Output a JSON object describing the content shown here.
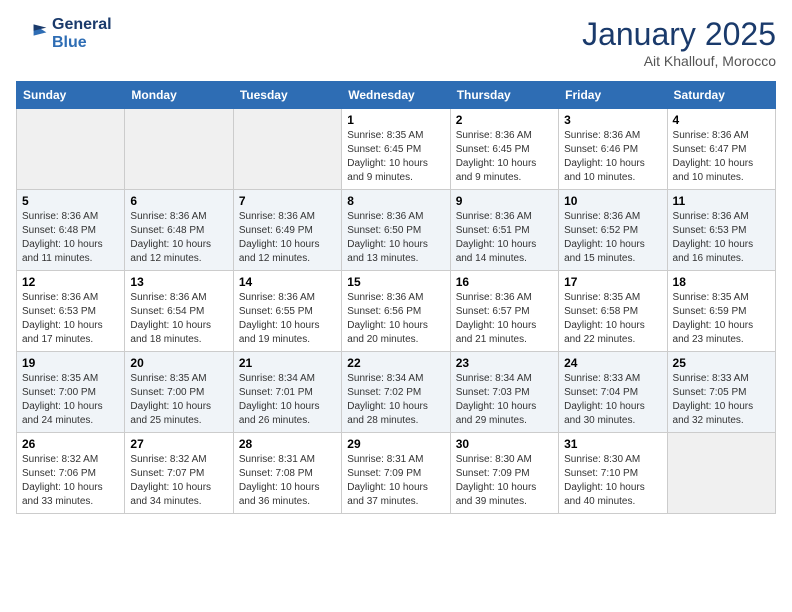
{
  "header": {
    "logo_line1": "General",
    "logo_line2": "Blue",
    "month": "January 2025",
    "location": "Ait Khallouf, Morocco"
  },
  "days_of_week": [
    "Sunday",
    "Monday",
    "Tuesday",
    "Wednesday",
    "Thursday",
    "Friday",
    "Saturday"
  ],
  "weeks": [
    [
      {
        "day": "",
        "info": ""
      },
      {
        "day": "",
        "info": ""
      },
      {
        "day": "",
        "info": ""
      },
      {
        "day": "1",
        "info": "Sunrise: 8:35 AM\nSunset: 6:45 PM\nDaylight: 10 hours\nand 9 minutes."
      },
      {
        "day": "2",
        "info": "Sunrise: 8:36 AM\nSunset: 6:45 PM\nDaylight: 10 hours\nand 9 minutes."
      },
      {
        "day": "3",
        "info": "Sunrise: 8:36 AM\nSunset: 6:46 PM\nDaylight: 10 hours\nand 10 minutes."
      },
      {
        "day": "4",
        "info": "Sunrise: 8:36 AM\nSunset: 6:47 PM\nDaylight: 10 hours\nand 10 minutes."
      }
    ],
    [
      {
        "day": "5",
        "info": "Sunrise: 8:36 AM\nSunset: 6:48 PM\nDaylight: 10 hours\nand 11 minutes."
      },
      {
        "day": "6",
        "info": "Sunrise: 8:36 AM\nSunset: 6:48 PM\nDaylight: 10 hours\nand 12 minutes."
      },
      {
        "day": "7",
        "info": "Sunrise: 8:36 AM\nSunset: 6:49 PM\nDaylight: 10 hours\nand 12 minutes."
      },
      {
        "day": "8",
        "info": "Sunrise: 8:36 AM\nSunset: 6:50 PM\nDaylight: 10 hours\nand 13 minutes."
      },
      {
        "day": "9",
        "info": "Sunrise: 8:36 AM\nSunset: 6:51 PM\nDaylight: 10 hours\nand 14 minutes."
      },
      {
        "day": "10",
        "info": "Sunrise: 8:36 AM\nSunset: 6:52 PM\nDaylight: 10 hours\nand 15 minutes."
      },
      {
        "day": "11",
        "info": "Sunrise: 8:36 AM\nSunset: 6:53 PM\nDaylight: 10 hours\nand 16 minutes."
      }
    ],
    [
      {
        "day": "12",
        "info": "Sunrise: 8:36 AM\nSunset: 6:53 PM\nDaylight: 10 hours\nand 17 minutes."
      },
      {
        "day": "13",
        "info": "Sunrise: 8:36 AM\nSunset: 6:54 PM\nDaylight: 10 hours\nand 18 minutes."
      },
      {
        "day": "14",
        "info": "Sunrise: 8:36 AM\nSunset: 6:55 PM\nDaylight: 10 hours\nand 19 minutes."
      },
      {
        "day": "15",
        "info": "Sunrise: 8:36 AM\nSunset: 6:56 PM\nDaylight: 10 hours\nand 20 minutes."
      },
      {
        "day": "16",
        "info": "Sunrise: 8:36 AM\nSunset: 6:57 PM\nDaylight: 10 hours\nand 21 minutes."
      },
      {
        "day": "17",
        "info": "Sunrise: 8:35 AM\nSunset: 6:58 PM\nDaylight: 10 hours\nand 22 minutes."
      },
      {
        "day": "18",
        "info": "Sunrise: 8:35 AM\nSunset: 6:59 PM\nDaylight: 10 hours\nand 23 minutes."
      }
    ],
    [
      {
        "day": "19",
        "info": "Sunrise: 8:35 AM\nSunset: 7:00 PM\nDaylight: 10 hours\nand 24 minutes."
      },
      {
        "day": "20",
        "info": "Sunrise: 8:35 AM\nSunset: 7:00 PM\nDaylight: 10 hours\nand 25 minutes."
      },
      {
        "day": "21",
        "info": "Sunrise: 8:34 AM\nSunset: 7:01 PM\nDaylight: 10 hours\nand 26 minutes."
      },
      {
        "day": "22",
        "info": "Sunrise: 8:34 AM\nSunset: 7:02 PM\nDaylight: 10 hours\nand 28 minutes."
      },
      {
        "day": "23",
        "info": "Sunrise: 8:34 AM\nSunset: 7:03 PM\nDaylight: 10 hours\nand 29 minutes."
      },
      {
        "day": "24",
        "info": "Sunrise: 8:33 AM\nSunset: 7:04 PM\nDaylight: 10 hours\nand 30 minutes."
      },
      {
        "day": "25",
        "info": "Sunrise: 8:33 AM\nSunset: 7:05 PM\nDaylight: 10 hours\nand 32 minutes."
      }
    ],
    [
      {
        "day": "26",
        "info": "Sunrise: 8:32 AM\nSunset: 7:06 PM\nDaylight: 10 hours\nand 33 minutes."
      },
      {
        "day": "27",
        "info": "Sunrise: 8:32 AM\nSunset: 7:07 PM\nDaylight: 10 hours\nand 34 minutes."
      },
      {
        "day": "28",
        "info": "Sunrise: 8:31 AM\nSunset: 7:08 PM\nDaylight: 10 hours\nand 36 minutes."
      },
      {
        "day": "29",
        "info": "Sunrise: 8:31 AM\nSunset: 7:09 PM\nDaylight: 10 hours\nand 37 minutes."
      },
      {
        "day": "30",
        "info": "Sunrise: 8:30 AM\nSunset: 7:09 PM\nDaylight: 10 hours\nand 39 minutes."
      },
      {
        "day": "31",
        "info": "Sunrise: 8:30 AM\nSunset: 7:10 PM\nDaylight: 10 hours\nand 40 minutes."
      },
      {
        "day": "",
        "info": ""
      }
    ]
  ]
}
